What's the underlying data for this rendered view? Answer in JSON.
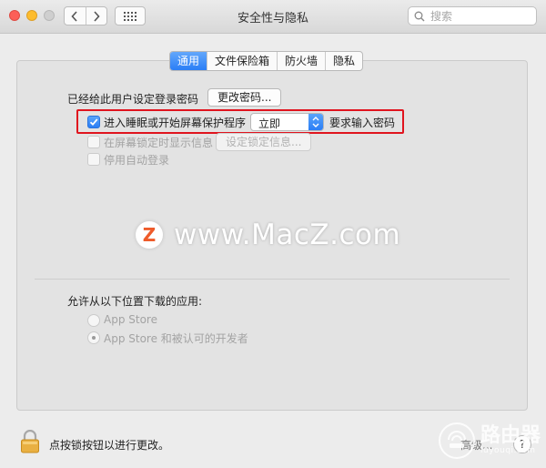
{
  "window": {
    "title": "安全性与隐私",
    "search_placeholder": "搜索"
  },
  "tabs": [
    {
      "label": "通用",
      "active": true
    },
    {
      "label": "文件保险箱",
      "active": false
    },
    {
      "label": "防火墙",
      "active": false
    },
    {
      "label": "隐私",
      "active": false
    }
  ],
  "general": {
    "password_set_label": "已经给此用户设定登录密码",
    "change_password_button": "更改密码...",
    "require_password": {
      "prefix": "进入睡眠或开始屏幕保护程序",
      "selected_option": "立即",
      "suffix": "要求输入密码",
      "checked": true
    },
    "show_message": {
      "label": "在屏幕锁定时显示信息",
      "button": "设定锁定信息...",
      "checked": false
    },
    "disable_auto_login": {
      "label": "停用自动登录",
      "checked": false
    }
  },
  "downloads": {
    "title": "允许从以下位置下载的应用:",
    "options": [
      {
        "label": "App Store",
        "selected": false
      },
      {
        "label": "App Store 和被认可的开发者",
        "selected": true
      }
    ]
  },
  "footer": {
    "lock_text": "点按锁按钮以进行更改。",
    "advanced_label": "高级...",
    "help_label": "?"
  },
  "watermarks": {
    "center_logo": "Z",
    "center_text": "www.MacZ.com",
    "corner_text": "路由器",
    "corner_sub": "luyouqi.com"
  },
  "colors": {
    "accent": "#2b7ef5",
    "highlight_box": "#e0141e"
  }
}
